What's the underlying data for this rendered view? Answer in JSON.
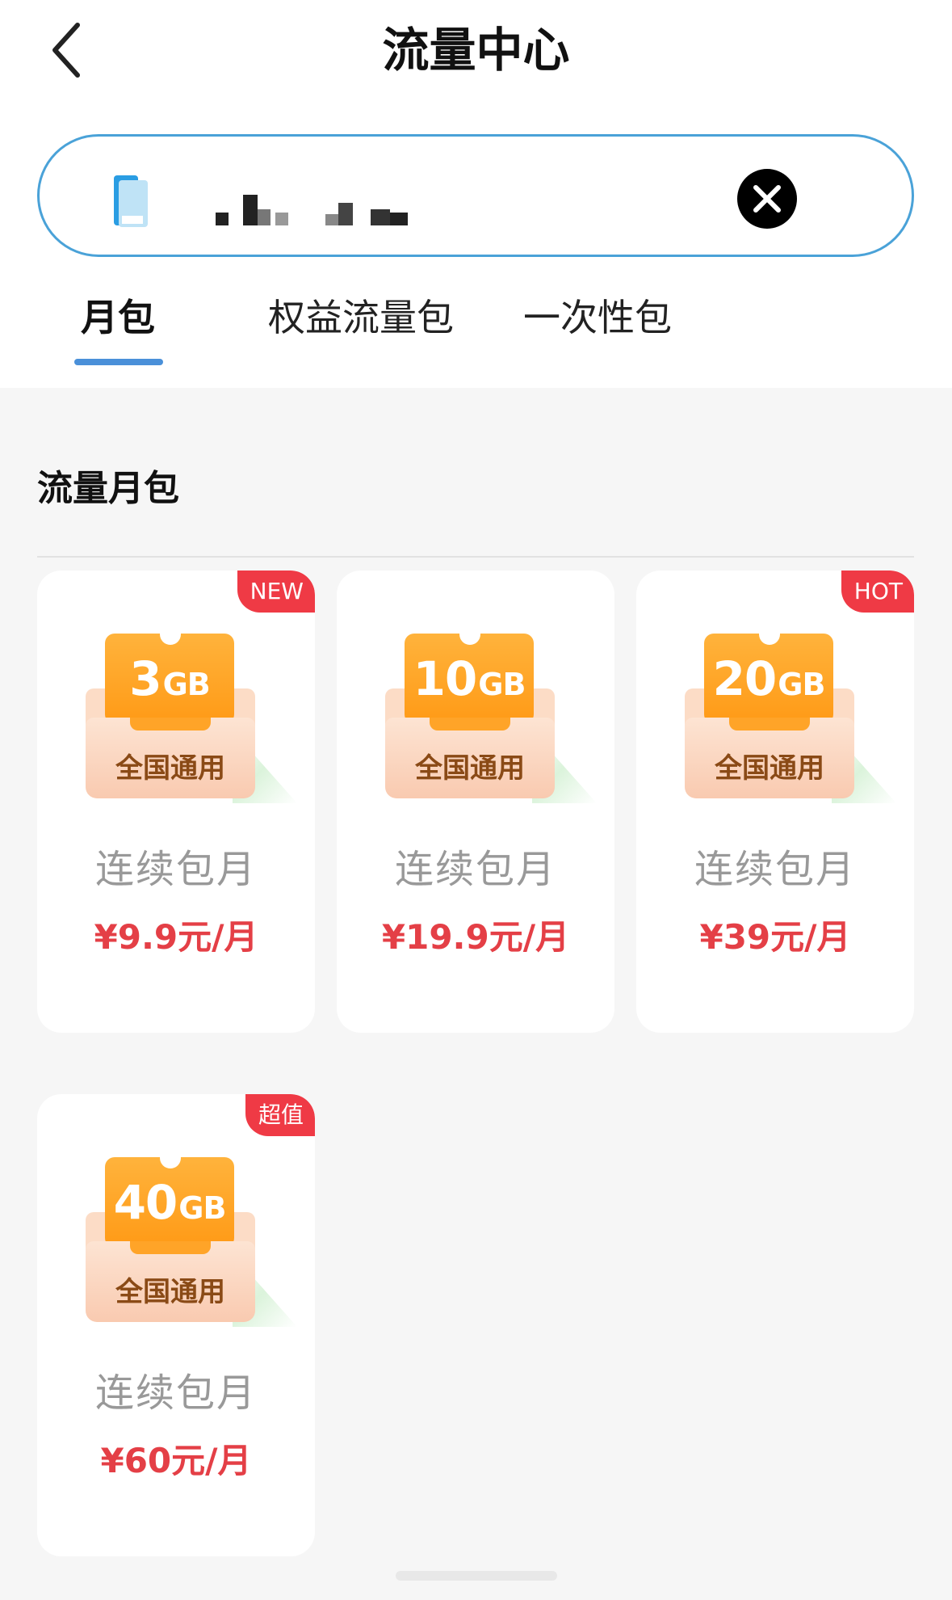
{
  "header": {
    "title": "流量中心"
  },
  "tabs": [
    {
      "label": "月包",
      "active": true
    },
    {
      "label": "权益流量包",
      "active": false
    },
    {
      "label": "一次性包",
      "active": false
    }
  ],
  "section": {
    "title": "流量月包"
  },
  "packages": [
    {
      "amount": "3",
      "unit": "GB",
      "scope": "全国通用",
      "desc": "连续包月",
      "price": "¥9.9元/月",
      "badge": "NEW"
    },
    {
      "amount": "10",
      "unit": "GB",
      "scope": "全国通用",
      "desc": "连续包月",
      "price": "¥19.9元/月",
      "badge": ""
    },
    {
      "amount": "20",
      "unit": "GB",
      "scope": "全国通用",
      "desc": "连续包月",
      "price": "¥39元/月",
      "badge": "HOT"
    },
    {
      "amount": "40",
      "unit": "GB",
      "scope": "全国通用",
      "desc": "连续包月",
      "price": "¥60元/月",
      "badge": "超值"
    }
  ],
  "colors": {
    "accent": "#4a90d9",
    "price": "#e43f46",
    "badge": "#ef3a45",
    "ticket": "#ff9a16"
  }
}
